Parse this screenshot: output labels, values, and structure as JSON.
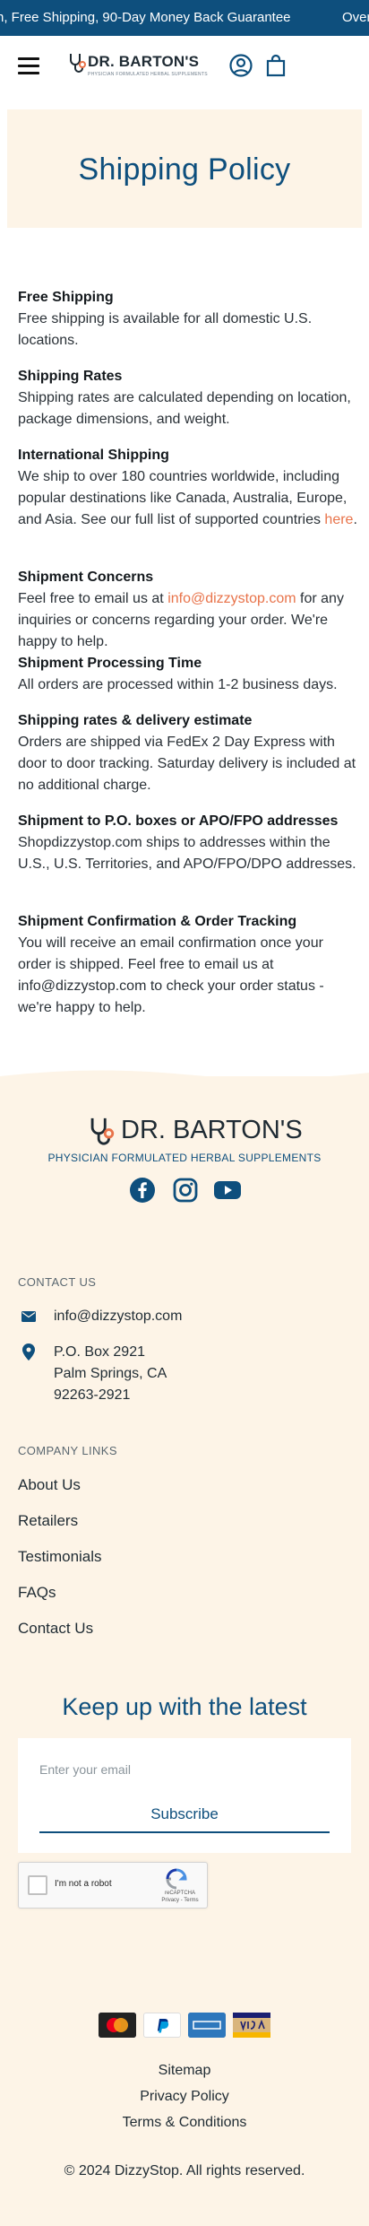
{
  "announcement": {
    "text_left": "n, Free Shipping, 90-Day Money Back Guarantee",
    "text_right": "Over"
  },
  "header": {
    "brand_name": "DR. BARTON'S",
    "brand_tagline": "PHYSICIAN FORMULATED HERBAL SUPPLEMENTS"
  },
  "hero": {
    "title": "Shipping Policy"
  },
  "policy": [
    {
      "heading": "Free Shipping",
      "body": "Free shipping is available for all domestic U.S. locations."
    },
    {
      "heading": "Shipping Rates",
      "body": "Shipping rates are calculated depending on location, package dimensions, and weight."
    },
    {
      "heading": "International Shipping",
      "body": "We ship to over 180 countries worldwide, including popular destinations like Canada, Australia, Europe, and Asia. See our full list of supported countries ",
      "link": "here",
      "tail": "."
    },
    {
      "heading": "Shipment Concerns",
      "body_pre": "Feel free to email us at ",
      "email": "info@dizzystop.com",
      "body_post": " for any inquiries or concerns regarding your order. We're happy to help."
    },
    {
      "heading": "Shipment Processing Time",
      "body": "All orders are processed within 1-2 business days."
    },
    {
      "heading": "Shipping rates & delivery estimate",
      "body": "Orders are shipped via FedEx 2 Day Express with door to door tracking. Saturday delivery is included at no additional charge."
    },
    {
      "heading": "Shipment to P.O. boxes or APO/FPO addresses",
      "body": "Shopdizzystop.com ships to addresses within the U.S., U.S. Territories, and APO/FPO/DPO addresses."
    },
    {
      "heading": "Shipment Confirmation & Order Tracking",
      "body": "You will receive an email confirmation once your order is shipped. Feel free to email us at info@dizzystop.com to check your order status - we're happy to help."
    }
  ],
  "footer": {
    "brand_name": "DR. BARTON'S",
    "brand_tagline": "PHYSICIAN FORMULATED HERBAL SUPPLEMENTS",
    "contact_heading": "CONTACT US",
    "email": "info@dizzystop.com",
    "address_line1": "P.O. Box 2921",
    "address_line2": "Palm Springs, CA",
    "address_line3": "92263-2921",
    "links_heading": "COMPANY LINKS",
    "company_links": [
      "About Us",
      "Retailers",
      "Testimonials",
      "FAQs",
      "Contact Us"
    ],
    "newsletter_title": "Keep up with the latest",
    "email_placeholder": "Enter your email",
    "subscribe_label": "Subscribe",
    "captcha_label": "I'm not a robot",
    "captcha_brand": "reCAPTCHA",
    "captcha_terms": "Privacy - Terms",
    "payment_methods": [
      "MasterCard",
      "PayPal",
      "American Express",
      "VISA"
    ],
    "bottom_links": [
      "Sitemap",
      "Privacy Policy",
      "Terms & Conditions"
    ],
    "copyright": "© 2024 DizzyStop. All rights reserved."
  },
  "colors": {
    "brand_blue": "#0e4f7d",
    "cream": "#fdf4e7",
    "accent_orange": "#e8734a"
  }
}
